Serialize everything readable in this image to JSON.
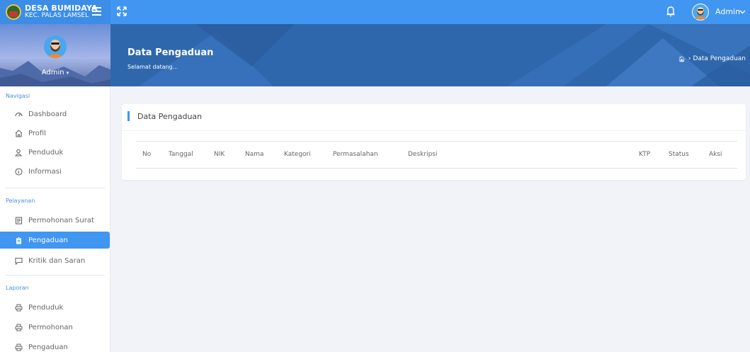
{
  "brand": {
    "name": "DESA BUMIDAYA",
    "subtitle": "KEC. PALAS LAMSEL"
  },
  "topbar": {
    "user_name": "Admin",
    "icons": [
      "hamburger-icon",
      "expand-icon",
      "bell-icon",
      "chevron-down-icon"
    ]
  },
  "sidebar": {
    "profile_name": "Admin",
    "sections": [
      {
        "title": "Navigasi",
        "items": [
          {
            "label": "Dashboard",
            "icon": "dashboard-icon"
          },
          {
            "label": "Profil",
            "icon": "home-icon"
          },
          {
            "label": "Penduduk",
            "icon": "users-icon"
          },
          {
            "label": "Informasi",
            "icon": "info-icon"
          }
        ]
      },
      {
        "title": "Pelayanan",
        "items": [
          {
            "label": "Permohonan Surat",
            "icon": "document-icon"
          },
          {
            "label": "Pengaduan",
            "icon": "clipboard-icon",
            "active": true
          },
          {
            "label": "Kritik dan Saran",
            "icon": "chat-icon"
          }
        ]
      },
      {
        "title": "Laporan",
        "items": [
          {
            "label": "Penduduk",
            "icon": "print-icon"
          },
          {
            "label": "Permohonan",
            "icon": "print-icon"
          },
          {
            "label": "Pengaduan",
            "icon": "print-icon"
          }
        ]
      }
    ]
  },
  "banner": {
    "title": "Data Pengaduan",
    "subtitle": "Selamat datang...",
    "breadcrumb": "Data Pengaduan"
  },
  "card": {
    "title": "Data Pengaduan",
    "columns": [
      "No",
      "Tanggal",
      "NIK",
      "Nama",
      "Kategori",
      "Permasalahan",
      "Deskripsi",
      "KTP",
      "Status",
      "Aksi"
    ]
  },
  "colors": {
    "primary": "#4096f0",
    "banner": "#2f67ad",
    "background": "#f1f3f8"
  }
}
